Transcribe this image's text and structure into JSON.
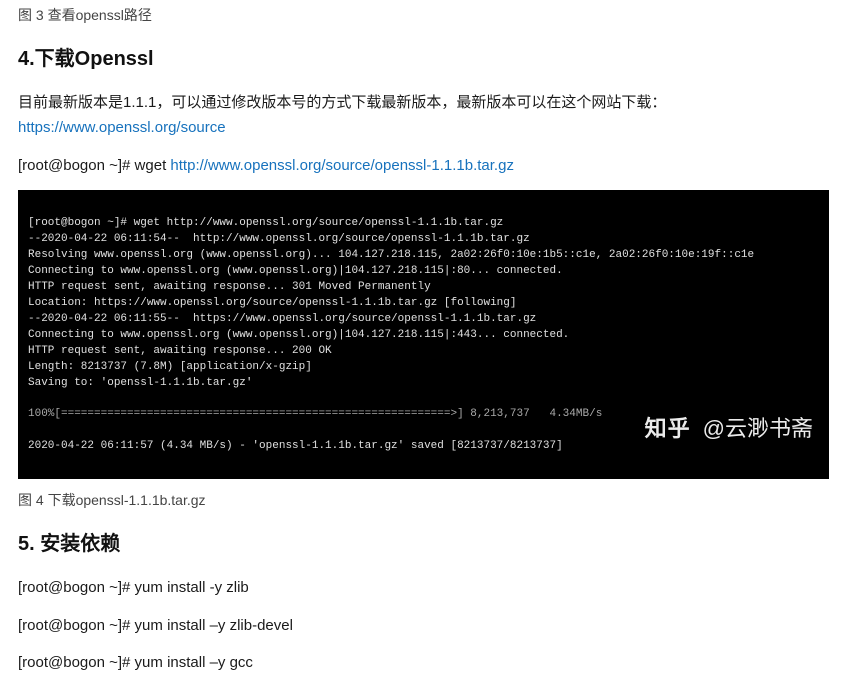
{
  "fig3_caption": "图 3 查看openssl路径",
  "section4": {
    "heading": "4.下载Openssl",
    "intro_pre": "目前最新版本是1.1.1，可以通过修改版本号的方式下载最新版本，最新版本可以在这个网站下载：",
    "intro_link": "https://www.openssl.org/source",
    "cmd_prefix": "[root@bogon ~]# wget ",
    "cmd_link": "http://www.openssl.org/source/openssl-1.1.1b.tar.gz"
  },
  "terminal_lines": {
    "l1": "[root@bogon ~]# wget http://www.openssl.org/source/openssl-1.1.1b.tar.gz",
    "l2": "--2020-04-22 06:11:54--  http://www.openssl.org/source/openssl-1.1.1b.tar.gz",
    "l3": "Resolving www.openssl.org (www.openssl.org)... 104.127.218.115, 2a02:26f0:10e:1b5::c1e, 2a02:26f0:10e:19f::c1e",
    "l4": "Connecting to www.openssl.org (www.openssl.org)|104.127.218.115|:80... connected.",
    "l5": "HTTP request sent, awaiting response... 301 Moved Permanently",
    "l6": "Location: https://www.openssl.org/source/openssl-1.1.1b.tar.gz [following]",
    "l7": "--2020-04-22 06:11:55--  https://www.openssl.org/source/openssl-1.1.1b.tar.gz",
    "l8": "Connecting to www.openssl.org (www.openssl.org)|104.127.218.115|:443... connected.",
    "l9": "HTTP request sent, awaiting response... 200 OK",
    "l10": "Length: 8213737 (7.8M) [application/x-gzip]",
    "l11": "Saving to: 'openssl-1.1.1b.tar.gz'",
    "l12": "",
    "l13": "100%[===========================================================>] 8,213,737   4.34MB/s",
    "l14": "",
    "l15": "2020-04-22 06:11:57 (4.34 MB/s) - 'openssl-1.1.1b.tar.gz' saved [8213737/8213737]"
  },
  "watermark": {
    "zhihu": "知乎",
    "handle": "@云渺书斋"
  },
  "fig4_caption": "图 4 下载openssl-1.1.1b.tar.gz",
  "section5": {
    "heading": "5. 安装依赖",
    "cmd1": "[root@bogon ~]# yum install -y zlib",
    "cmd2": "[root@bogon ~]# yum install –y zlib-devel",
    "cmd3": "[root@bogon ~]# yum install –y gcc"
  }
}
